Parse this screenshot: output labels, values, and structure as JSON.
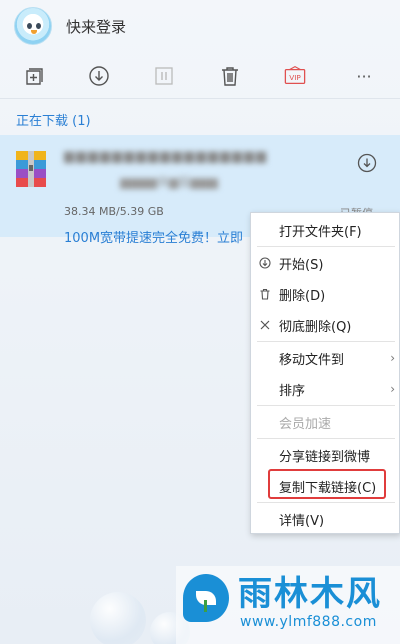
{
  "header": {
    "login_text": "快来登录"
  },
  "toolbar": {
    "icons": [
      "new-task-icon",
      "download-icon",
      "pause-icon",
      "trash-icon",
      "vip-icon",
      "more-icon"
    ],
    "vip_label": "VIP",
    "more_label": "···"
  },
  "section": {
    "title": "正在下载 (1)"
  },
  "download": {
    "file_name_blurred": "▆▆▆▆▆▆▆▆▆▆▆▆▆▆▆▆▆",
    "file_name_blurred2": "▆▆▆▆体▆版▆▆▆",
    "size": "38.34 MB/5.39 GB",
    "status": "已暂停",
    "promo": "100M宽带提速完全免费！立即"
  },
  "context_menu": {
    "items": [
      {
        "label": "打开文件夹(F)",
        "icon": "",
        "submenu": false,
        "disabled": false
      },
      {
        "label": "开始(S)",
        "icon": "start-icon",
        "submenu": false,
        "disabled": false
      },
      {
        "label": "删除(D)",
        "icon": "trash-icon",
        "submenu": false,
        "disabled": false
      },
      {
        "label": "彻底删除(Q)",
        "icon": "close-icon",
        "submenu": false,
        "disabled": false
      },
      {
        "label": "移动文件到",
        "icon": "",
        "submenu": true,
        "disabled": false
      },
      {
        "label": "排序",
        "icon": "",
        "submenu": true,
        "disabled": false
      },
      {
        "label": "会员加速",
        "icon": "",
        "submenu": false,
        "disabled": true
      },
      {
        "label": "分享链接到微博",
        "icon": "",
        "submenu": false,
        "disabled": false
      },
      {
        "label": "复制下载链接(C)",
        "icon": "",
        "submenu": false,
        "disabled": false
      },
      {
        "label": "详情(V)",
        "icon": "",
        "submenu": false,
        "disabled": false
      }
    ],
    "submenu_arrow": "›",
    "highlight_color": "#e03c3c"
  },
  "watermark": {
    "title": "雨林木风",
    "url": "www.ylmf888.com"
  },
  "colors": {
    "accent": "#2a7fd4",
    "row_bg": "#d7ebfa",
    "watermark": "#1a8fd6"
  }
}
